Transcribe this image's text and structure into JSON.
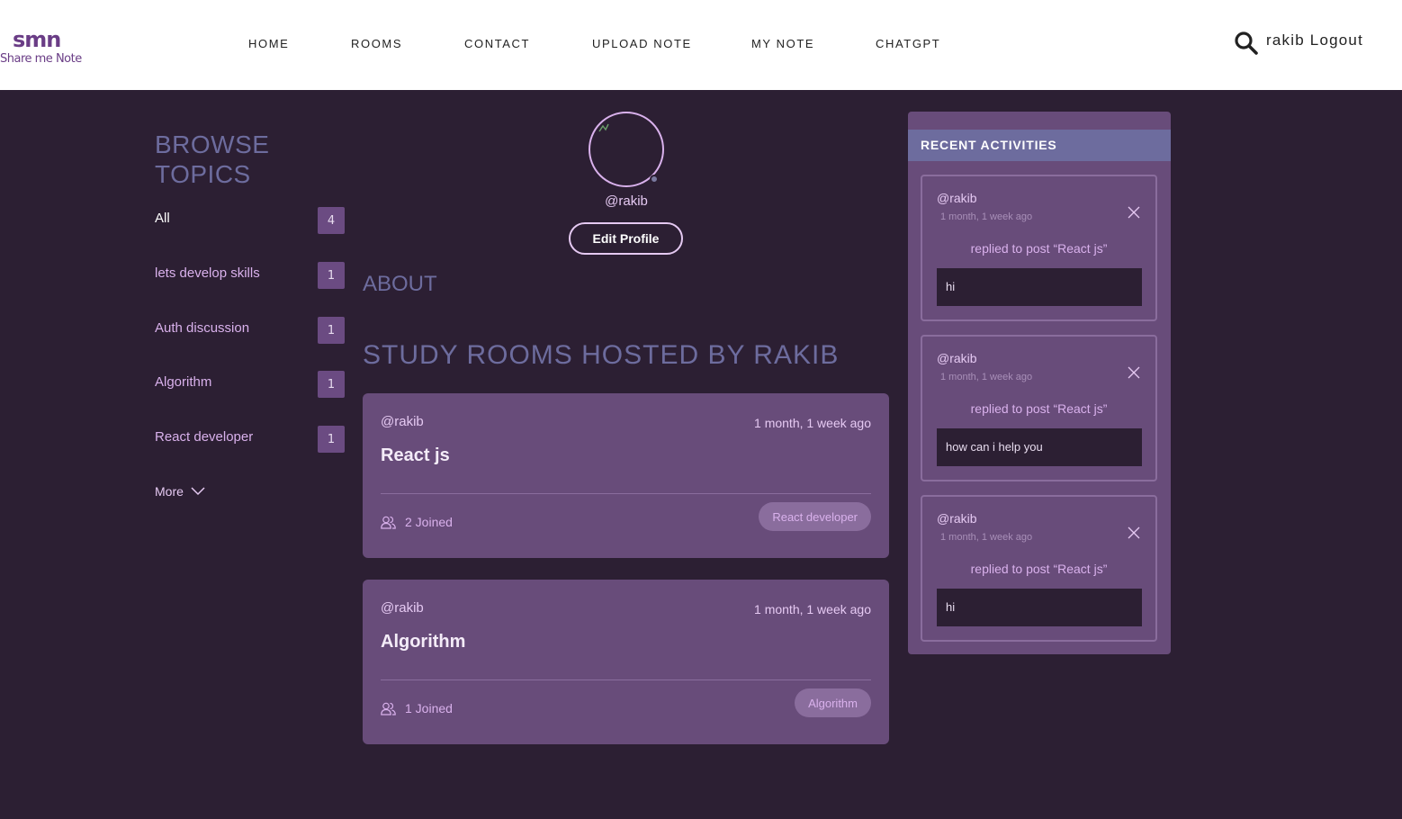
{
  "header": {
    "logo_mark": "smn",
    "logo_text": "Share me Note",
    "nav": [
      "HOME",
      "ROOMS",
      "CONTACT",
      "UPLOAD NOTE",
      "MY NOTE",
      "CHATGPT"
    ],
    "username": "rakib",
    "logout_label": "Logout"
  },
  "sidebar": {
    "title_line1": "BROWSE",
    "title_line2": "TOPICS",
    "topics": [
      {
        "label": "All",
        "count": "4"
      },
      {
        "label": "lets develop skills",
        "count": "1"
      },
      {
        "label": "Auth discussion",
        "count": "1"
      },
      {
        "label": "Algorithm",
        "count": "1"
      },
      {
        "label": "React developer",
        "count": "1"
      }
    ],
    "more_label": "More"
  },
  "profile": {
    "handle": "@rakib",
    "edit_label": "Edit Profile",
    "about_title": "ABOUT",
    "rooms_title": "STUDY ROOMS HOSTED BY RAKIB"
  },
  "rooms": [
    {
      "host": "@rakib",
      "time": "1 month, 1 week ago",
      "name": "React js",
      "joined": "2 Joined",
      "tag": "React developer"
    },
    {
      "host": "@rakib",
      "time": "1 month, 1 week ago",
      "name": "Algorithm",
      "joined": "1 Joined",
      "tag": "Algorithm"
    }
  ],
  "activities": {
    "title": "RECENT ACTIVITIES",
    "items": [
      {
        "user": "@rakib",
        "time": "1 month, 1 week ago",
        "desc": "replied to post “React js”",
        "body": "hi"
      },
      {
        "user": "@rakib",
        "time": "1 month, 1 week ago",
        "desc": "replied to post “React js”",
        "body": "how can i help you"
      },
      {
        "user": "@rakib",
        "time": "1 month, 1 week ago",
        "desc": "replied to post “React js”",
        "body": "hi"
      }
    ]
  },
  "colors": {
    "background": "#2c1f33",
    "card": "#684c7a",
    "accent": "#d9b1ec",
    "heading": "#6d6c9e"
  }
}
